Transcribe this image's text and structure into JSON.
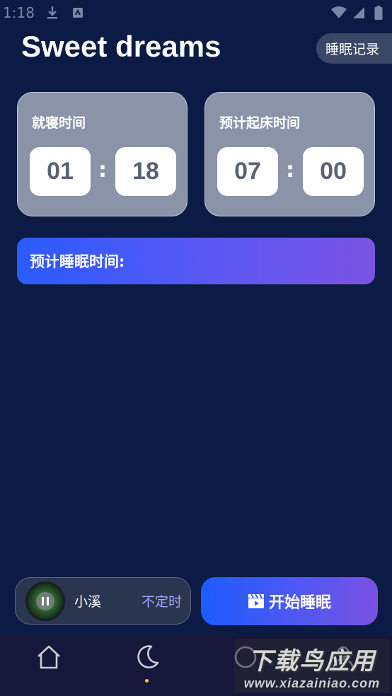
{
  "status_bar": {
    "time": "1:18",
    "icons": [
      "download-icon",
      "notification-app-icon",
      "wifi-icon",
      "cellular-signal-icon",
      "battery-icon"
    ]
  },
  "header": {
    "title": "Sweet dreams",
    "record_button": "睡眠记录"
  },
  "bedtime": {
    "label": "就寝时间",
    "hour": "01",
    "minute": "18",
    "separator": ":"
  },
  "wake_time": {
    "label": "预计起床时间",
    "hour": "07",
    "minute": "00",
    "separator": ":"
  },
  "estimate": {
    "label": "预计睡眠时间:"
  },
  "player": {
    "track_name": "小溪",
    "timer_mode": "不定时",
    "state_icon": "pause-icon"
  },
  "start_button": {
    "label": "开始睡眠",
    "icon": "clapperboard-icon"
  },
  "bottom_nav": {
    "items": [
      {
        "icon": "home-icon",
        "active": false
      },
      {
        "icon": "moon-icon",
        "active": true
      },
      {
        "icon": "discover-icon",
        "active": false
      },
      {
        "icon": "profile-icon",
        "active": false
      }
    ]
  },
  "watermark": {
    "cn": "下载鸟应用",
    "en": "www.xiazainiao.com"
  },
  "colors": {
    "background": "#0b1b45",
    "card": "#8a93a7",
    "accent_start": "#1d5bff",
    "accent_end": "#7a52e2",
    "nav_dot": "#f5c842"
  }
}
